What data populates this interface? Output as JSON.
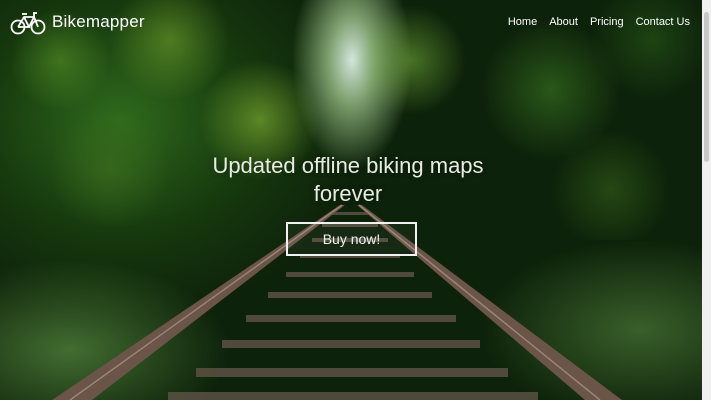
{
  "brand": {
    "name": "Bikemapper",
    "icon": "bicycle-icon"
  },
  "nav": {
    "items": [
      {
        "label": "Home"
      },
      {
        "label": "About"
      },
      {
        "label": "Pricing"
      },
      {
        "label": "Contact Us"
      }
    ]
  },
  "hero": {
    "headline_line1": "Updated offline biking maps",
    "headline_line2": "forever",
    "cta_label": "Buy now!",
    "background": "forest railway track photo"
  },
  "colors": {
    "text": "#ffffff",
    "button_border": "#f2f2f2"
  }
}
